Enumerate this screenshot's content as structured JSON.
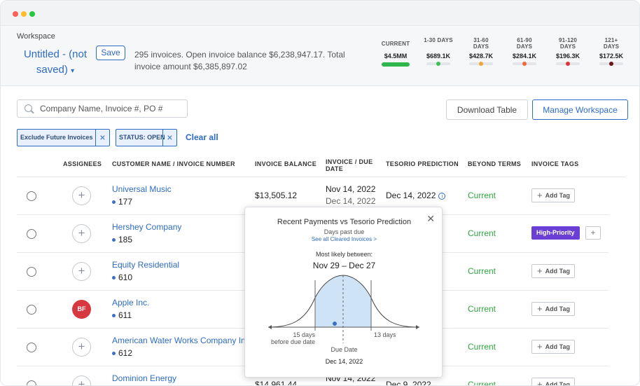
{
  "window": {
    "controls": [
      "close",
      "minimize",
      "maximize"
    ]
  },
  "header": {
    "workspace_label": "Workspace",
    "workspace_title": "Untitled - (not saved)",
    "save_label": "Save",
    "summary": "295 invoices. Open invoice balance $6,238,947.17. Total invoice amount $6,385,897.02",
    "aging": [
      {
        "label": "CURRENT",
        "value": "$4.5MM",
        "color": "#2fb64a"
      },
      {
        "label": "1-30 DAYS",
        "value": "$689.1K",
        "color": "#3cc24f"
      },
      {
        "label": "31-60 DAYS",
        "value": "$428.7K",
        "color": "#f2a33a"
      },
      {
        "label": "61-90 DAYS",
        "value": "$284.1K",
        "color": "#ef6a3a"
      },
      {
        "label": "91-120 DAYS",
        "value": "$196.3K",
        "color": "#e0343b"
      },
      {
        "label": "121+ DAYS",
        "value": "$172.5K",
        "color": "#6a1414"
      }
    ]
  },
  "toolbar": {
    "search_placeholder": "Company Name, Invoice #, PO #",
    "download_label": "Download Table",
    "manage_label": "Manage Workspace"
  },
  "filters": {
    "chips": [
      "Exclude Future Invoices",
      "Status: OPEN"
    ],
    "clear_all": "Clear all"
  },
  "table": {
    "headers": [
      "ASSIGNEES",
      "CUSTOMER NAME / INVOICE NUMBER",
      "INVOICE BALANCE",
      "INVOICE / DUE DATE",
      "TESORIO PREDICTION",
      "BEYOND TERMS",
      "INVOICE TAGS"
    ],
    "add_tag_label": "Add Tag",
    "rows": [
      {
        "customer": "Universal Music",
        "invoice": "177",
        "balance": "$13,505.12",
        "invoice_date": "Nov 14, 2022",
        "due_date": "Dec 14, 2022",
        "prediction": "Dec 14, 2022",
        "beyond": "Current",
        "assignee": ""
      },
      {
        "customer": "Hershey Company",
        "invoice": "185",
        "beyond": "Current",
        "tag": "High-Priority",
        "assignee": ""
      },
      {
        "customer": "Equity Residential",
        "invoice": "610",
        "beyond": "Current",
        "assignee": ""
      },
      {
        "customer": "Apple Inc.",
        "invoice": "611",
        "beyond": "Current",
        "assignee": "BF"
      },
      {
        "customer": "American Water Works Company Inc",
        "invoice": "612",
        "beyond": "Current",
        "assignee": ""
      },
      {
        "customer": "Dominion Energy",
        "invoice": "",
        "balance": "$14,961.44",
        "invoice_date": "Nov 14, 2022",
        "prediction": "Dec 9, 2022",
        "beyond": "Current",
        "assignee": ""
      }
    ]
  },
  "popover": {
    "title": "Recent Payments vs Tesorio Prediction",
    "subtitle": "Days past due",
    "link": "See all Cleared Invoices >",
    "likely_label": "Most likely between:",
    "range": "Nov 29 – Dec 27",
    "left_label_1": "15 days",
    "left_label_2": "before due date",
    "right_label": "13 days",
    "due_label": "Due Date",
    "due_date": "Dec 14, 2022"
  }
}
